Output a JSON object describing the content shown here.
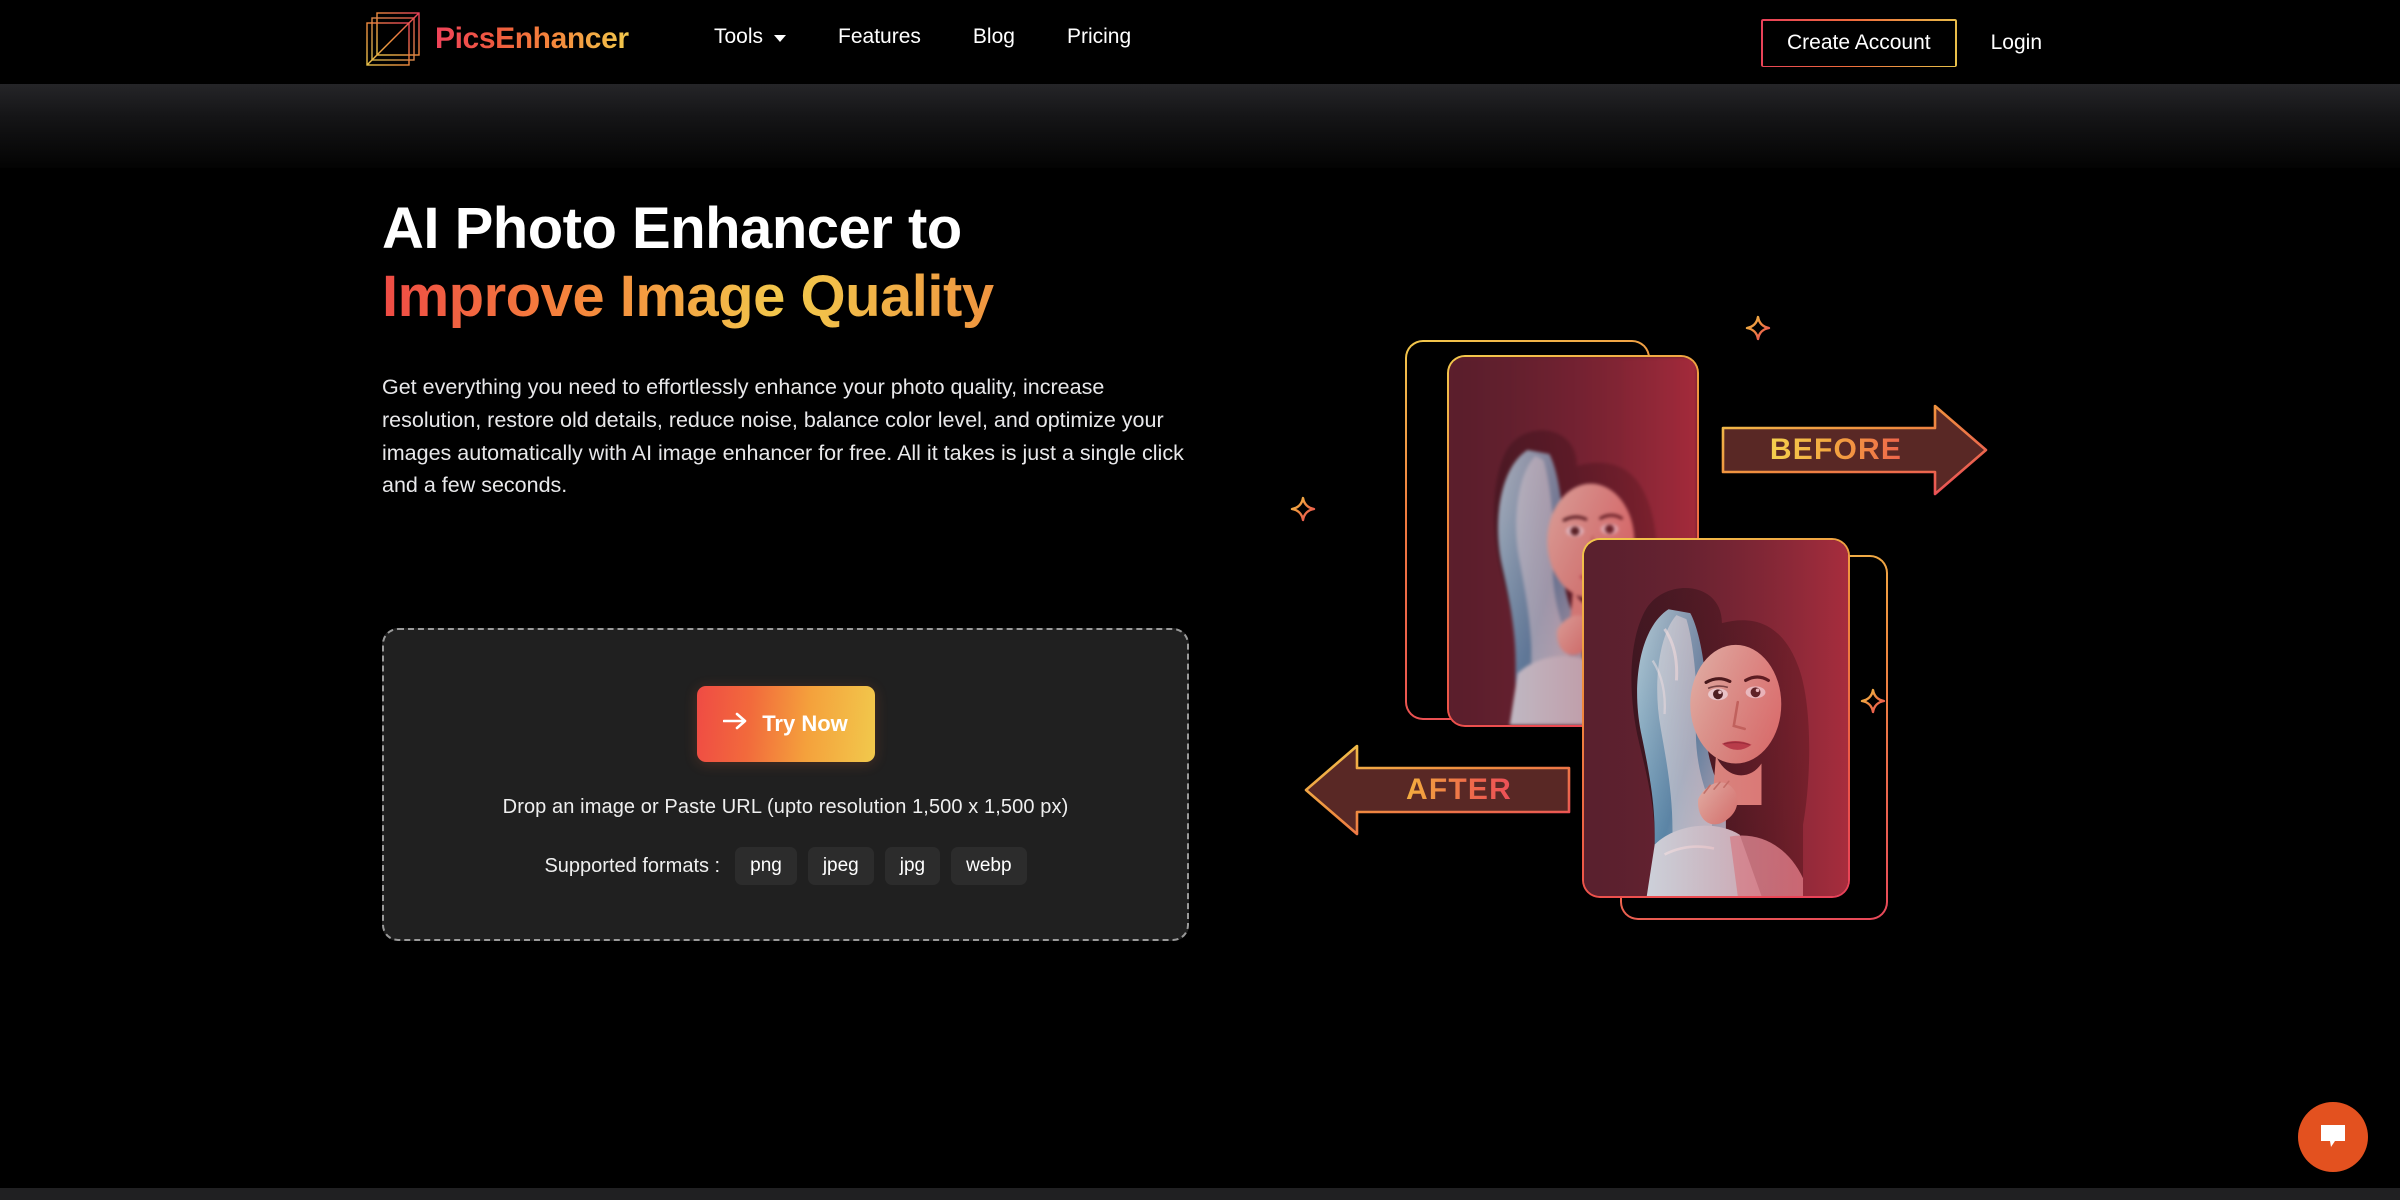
{
  "brand": {
    "name_part1": "Pics",
    "name_part2": "Enhancer",
    "logo_icon": "stacked-squares-logo-icon"
  },
  "nav": {
    "items": [
      {
        "label": "Tools",
        "has_dropdown": true,
        "icon": "chevron-down-icon"
      },
      {
        "label": "Features",
        "has_dropdown": false
      },
      {
        "label": "Blog",
        "has_dropdown": false
      },
      {
        "label": "Pricing",
        "has_dropdown": false
      }
    ]
  },
  "auth": {
    "create_account_label": "Create Account",
    "login_label": "Login"
  },
  "hero": {
    "heading_line1": "AI Photo Enhancer to",
    "heading_line2": "Improve Image Quality",
    "paragraph": "Get everything you need to effortlessly enhance your photo quality, increase resolution, restore old details, reduce noise, balance color level, and optimize your images automatically with AI image enhancer for free. All it takes is just a single click and a few seconds."
  },
  "upload": {
    "cta_label": "Try Now",
    "cta_icon": "arrow-right-icon",
    "drop_hint": "Drop an image or Paste URL (upto resolution 1,500 x 1,500 px)",
    "formats_label": "Supported formats :",
    "formats": [
      "png",
      "jpeg",
      "jpg",
      "webp"
    ]
  },
  "illustration": {
    "before_label": "BEFORE",
    "after_label": "AFTER",
    "sparkle_icon": "sparkle-x-icon",
    "card_alt": "portrait-photo"
  },
  "chat": {
    "icon": "chat-bubble-icon",
    "accent_color": "#e3511f"
  },
  "colors": {
    "background": "#000000",
    "gradient_start": "#ef4b44",
    "gradient_mid": "#f5853b",
    "gradient_end": "#f2c94c",
    "upload_box": "#202020",
    "pill": "#2c2c2c"
  }
}
